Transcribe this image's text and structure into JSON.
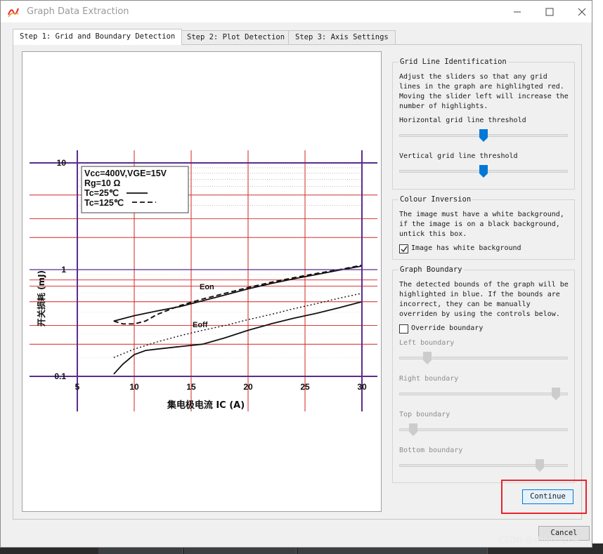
{
  "window": {
    "title": "Graph Data Extraction",
    "controls": [
      "minimize",
      "maximize",
      "close"
    ]
  },
  "tabs": [
    {
      "label": "Step 1: Grid and Boundary Detection",
      "active": true
    },
    {
      "label": "Step 2: Plot Detection",
      "active": false
    },
    {
      "label": "Step 3: Axis Settings",
      "active": false
    }
  ],
  "graph_image": {
    "legend": [
      "Vcc=400V,VGE=15V",
      "Rg=10 Ω",
      "Tc=25℃",
      "Tc=125℃"
    ],
    "ylabel": "开关损耗 (mJ)",
    "xlabel": "集电极电流 IC (A)",
    "y_ticks": [
      "10",
      "1",
      "0.1"
    ],
    "x_ticks": [
      "5",
      "10",
      "15",
      "20",
      "25",
      "30"
    ],
    "curve_labels": [
      "Eon",
      "Eoff"
    ]
  },
  "chart_data": {
    "type": "line",
    "title": "",
    "xlabel": "集电极电流 IC (A)",
    "ylabel": "开关损耗 (mJ)",
    "xlim": [
      5,
      30
    ],
    "ylim": [
      0.1,
      10
    ],
    "yscale": "log",
    "series": [
      {
        "name": "Eon",
        "temp": "Tc=25℃",
        "x": [
          8.2,
          10,
          12,
          14,
          16,
          18,
          20,
          22,
          24,
          26,
          28,
          30
        ],
        "y": [
          0.33,
          0.37,
          0.41,
          0.45,
          0.51,
          0.58,
          0.66,
          0.74,
          0.82,
          0.9,
          0.99,
          1.08
        ]
      },
      {
        "name": "Eon",
        "temp": "Tc=125℃",
        "x": [
          8.2,
          9,
          10,
          11,
          12,
          14,
          16,
          18,
          20,
          22,
          24,
          26,
          28,
          30
        ],
        "y": [
          0.33,
          0.31,
          0.31,
          0.33,
          0.38,
          0.46,
          0.53,
          0.6,
          0.68,
          0.76,
          0.84,
          0.92,
          1.0,
          1.1
        ]
      },
      {
        "name": "Eoff",
        "temp": "Tc=25℃",
        "x": [
          8.2,
          9,
          10,
          11,
          12,
          14,
          16,
          18,
          20,
          22,
          24,
          26,
          28,
          30
        ],
        "y": [
          0.105,
          0.13,
          0.16,
          0.175,
          0.18,
          0.19,
          0.2,
          0.23,
          0.27,
          0.31,
          0.35,
          0.39,
          0.44,
          0.5
        ]
      },
      {
        "name": "Eoff",
        "temp": "Tc=125℃",
        "x": [
          8.2,
          10,
          12,
          14,
          16,
          18,
          20,
          22,
          24,
          26,
          28,
          30
        ],
        "y": [
          0.15,
          0.18,
          0.21,
          0.24,
          0.27,
          0.3,
          0.34,
          0.38,
          0.43,
          0.48,
          0.54,
          0.6
        ]
      }
    ],
    "highlighted_grid": {
      "vertical_x": [
        5,
        10,
        15,
        20,
        25,
        30
      ],
      "horizontal_y": [
        0.1,
        0.2,
        0.3,
        0.5,
        0.7,
        0.8,
        1,
        2,
        3,
        5,
        10
      ]
    },
    "grid": true
  },
  "grid_group": {
    "title": "Grid Line Identification",
    "description": [
      "Adjust the sliders so that any grid",
      "lines in the graph are highlihgted red.",
      "Moving the slider left will increase the",
      "number of highlights."
    ],
    "h_label": "Horizontal grid line threshold",
    "h_value": 0.5,
    "v_label": "Vertical grid line threshold",
    "v_value": 0.5
  },
  "colour_group": {
    "title": "Colour Inversion",
    "description": [
      "The image must have a white background,",
      "if the image is on a black background,",
      "untick this box."
    ],
    "checkbox_label": "Image has white background",
    "checked": true
  },
  "boundary_group": {
    "title": "Graph Boundary",
    "description": [
      "The detected bounds of the graph will be",
      "highlighted in blue. If the bounds are",
      "incorrect, they can be manually",
      "overriden by using the controls below."
    ],
    "override_label": "Override boundary",
    "override_checked": false,
    "left_label": "Left boundary",
    "left_value": 0.15,
    "right_label": "Right boundary",
    "right_value": 0.95,
    "top_label": "Top boundary",
    "top_value": 0.06,
    "bottom_label": "Bottom boundary",
    "bottom_value": 0.85
  },
  "buttons": {
    "continue": "Continue",
    "cancel": "Cancel"
  },
  "watermark": "CSDN @shiyongxie",
  "colors": {
    "grid_highlight": "#d62020",
    "boundary_highlight": "#5a2c8c",
    "slider_active": "#0078d7",
    "slider_disabled": "#cccccc",
    "annotation_box": "#e8242b"
  }
}
